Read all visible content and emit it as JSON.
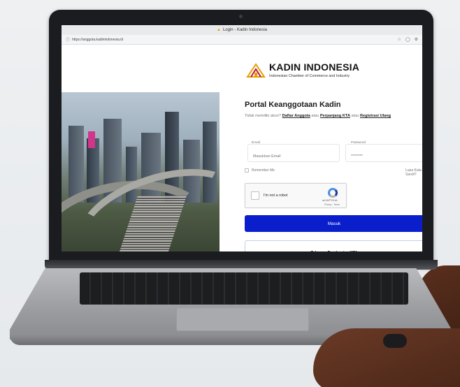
{
  "window": {
    "title": "Login - Kadin Indonesia",
    "url": "https://anggota.kadinindonesia.id"
  },
  "brand": {
    "name": "KADIN INDONESIA",
    "tagline": "Indonesian Chamber of Commerce and Industry"
  },
  "portal": {
    "title": "Portal Keanggotaan Kadin",
    "prompt": "Tidak memiliki akun?",
    "link_register": "Daftar Anggota",
    "sep1": "atau",
    "link_extend": "Perpanjang KTA",
    "sep2": "atau",
    "link_reregister": "Registrasi Ulang"
  },
  "form": {
    "email_label": "Email",
    "email_placeholder": "Masukkan Email",
    "password_label": "Password",
    "password_value": "********",
    "remember_label": "Remember Me",
    "forgot_label": "Lupa Kata Sandi?",
    "submit_label": "Masuk",
    "tahapan_label": "Tahapan Pembuatan KTA"
  },
  "captcha": {
    "label": "I'm not a robot",
    "brand": "reCAPTCHA",
    "terms": "Privacy - Terms"
  },
  "colors": {
    "primary": "#0a1ecc",
    "logo_gold": "#e0a000",
    "logo_red": "#c8102e"
  }
}
